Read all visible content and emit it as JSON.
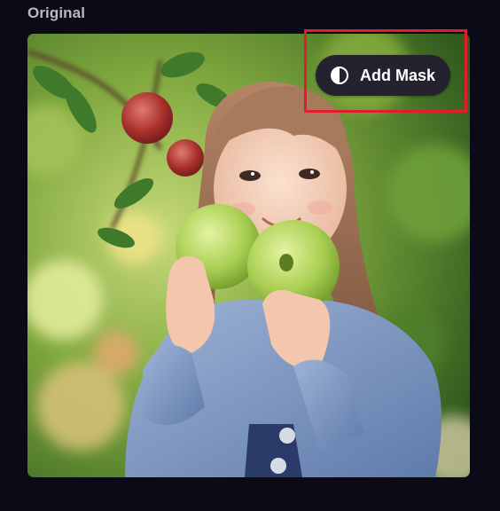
{
  "panel": {
    "title": "Original"
  },
  "image": {
    "subject": "photo"
  },
  "toolbar": {
    "add_mask_label": "Add Mask",
    "add_mask_icon": "contrast-half-circle-icon"
  },
  "colors": {
    "background": "#0b0a17",
    "title_text": "#b9bac6",
    "button_bg": "#23222e",
    "button_text": "#ffffff",
    "highlight_border": "#e11d2b"
  }
}
